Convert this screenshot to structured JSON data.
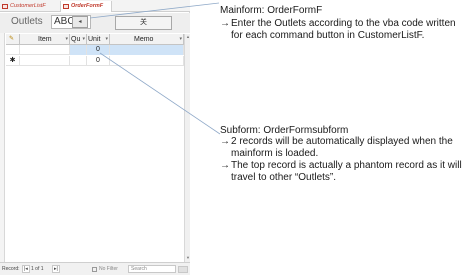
{
  "tabs": [
    {
      "label": "CustomerListF"
    },
    {
      "label": "OrderFormF"
    }
  ],
  "mainform": {
    "outlets_label": "Outlets",
    "outlets_value": "ABC",
    "nav_button": "◂",
    "command_button": "关"
  },
  "subform": {
    "columns": [
      "Item",
      "Qu",
      "Unit",
      "Memo"
    ],
    "rows": [
      {
        "selector": "",
        "item": "",
        "qu": "",
        "unit": "0",
        "memo": ""
      },
      {
        "selector": "✱",
        "item": "",
        "qu": "",
        "unit": "0",
        "memo": ""
      }
    ],
    "header_selector": "✎"
  },
  "status_bar": {
    "record_label": "Record:",
    "nav_first": "|◂",
    "position": "1 of 1",
    "nav_last": "▸|",
    "filter": "No Filter",
    "search": "Search"
  },
  "annotations": {
    "mainform": {
      "title": "Mainform: OrderFormF",
      "bullets": [
        "Enter the Outlets according to the vba code written for each command button in CustomerListF."
      ]
    },
    "subform": {
      "title": "Subform: OrderFormsubform",
      "bullets": [
        "2 records will be automatically displayed when the mainform is loaded.",
        "The top record is actually a phantom record as it will travel to other “Outlets”."
      ]
    },
    "arrow_glyph": "→"
  }
}
